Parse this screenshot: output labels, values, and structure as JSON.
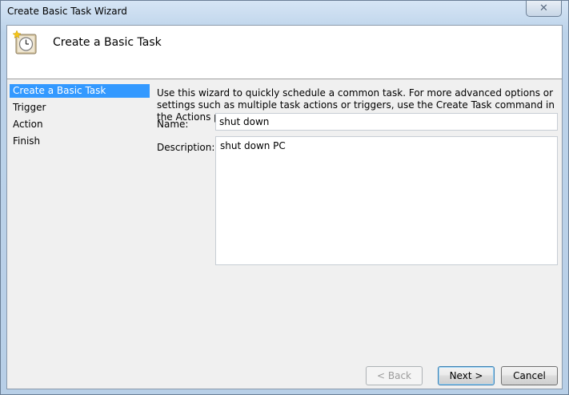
{
  "window": {
    "title": "Create Basic Task Wizard",
    "close_label": "✕"
  },
  "header": {
    "title": "Create a Basic Task",
    "icon": "scheduled-task-clock-icon"
  },
  "nav": {
    "items": [
      {
        "label": "Create a Basic Task",
        "active": true
      },
      {
        "label": "Trigger",
        "active": false
      },
      {
        "label": "Action",
        "active": false
      },
      {
        "label": "Finish",
        "active": false
      }
    ]
  },
  "main": {
    "intro": "Use this wizard to quickly schedule a common task.  For more advanced options or settings such as multiple task actions or triggers, use the Create Task command in the Actions pane.",
    "name_label": "Name:",
    "name_value": "shut down",
    "description_label": "Description:",
    "description_value": "shut down PC"
  },
  "buttons": {
    "back": "< Back",
    "next": "Next >",
    "cancel": "Cancel"
  },
  "colors": {
    "selection": "#3399ff",
    "frame": "#bcd3ea"
  }
}
